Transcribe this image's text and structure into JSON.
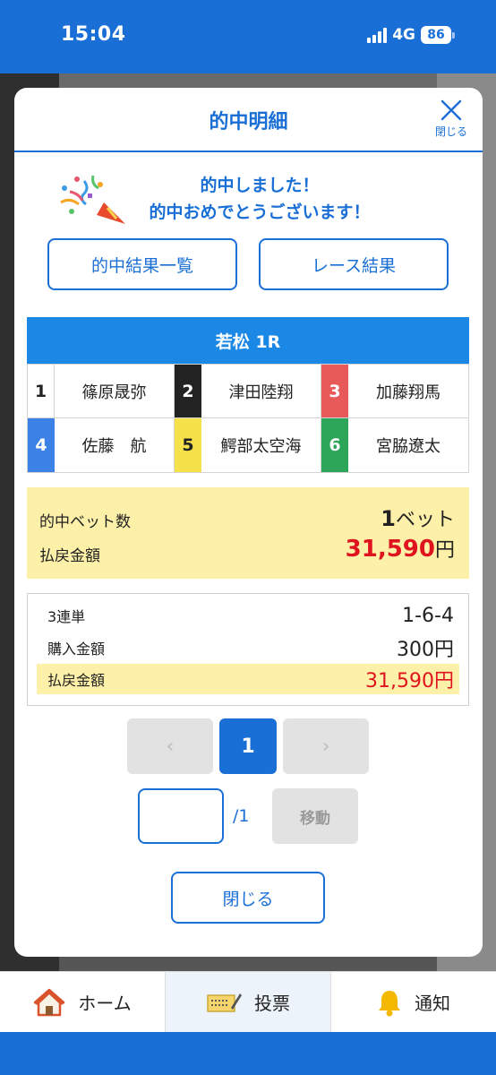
{
  "status_bar": {
    "time": "15:04",
    "network": "4G",
    "battery": "86"
  },
  "modal": {
    "title": "的中明細",
    "close_label": "閉じる",
    "congrats_line1": "的中しました！",
    "congrats_line2": "的中おめでとうございます！",
    "buttons": {
      "hit_list": "的中結果一覧",
      "race_result": "レース結果"
    },
    "race": {
      "title": "若松 1R",
      "racers": [
        {
          "lane": "1",
          "name": "篠原晟弥",
          "color": "#ffffff"
        },
        {
          "lane": "2",
          "name": "津田陸翔",
          "color": "#222222"
        },
        {
          "lane": "3",
          "name": "加藤翔馬",
          "color": "#e85a5a"
        },
        {
          "lane": "4",
          "name": "佐藤　航",
          "color": "#3c82e6"
        },
        {
          "lane": "5",
          "name": "鰐部太空海",
          "color": "#f5e14a"
        },
        {
          "lane": "6",
          "name": "宮脇遼太",
          "color": "#2ea65a"
        }
      ]
    },
    "summary": {
      "hit_bets_label": "的中ベット数",
      "hit_bets_value": "1",
      "hit_bets_unit": "ベット",
      "payout_label": "払戻金額",
      "payout_value": "31,590",
      "payout_unit": "円"
    },
    "bet_detail": {
      "type": "3連単",
      "combination": "1-6-4",
      "purchase_label": "購入金額",
      "purchase_value": "300円",
      "payout_label": "払戻金額",
      "payout_value": "31,590円"
    },
    "pagination": {
      "prev": "‹",
      "current": "1",
      "next": "›",
      "total": "/1",
      "jump_label": "移動",
      "jump_value": ""
    },
    "close_button": "閉じる"
  },
  "bottom_nav": {
    "items": [
      {
        "label": "ホーム",
        "icon": "home-icon"
      },
      {
        "label": "投票",
        "icon": "ticket-icon"
      },
      {
        "label": "通知",
        "icon": "bell-icon"
      }
    ],
    "active": "投票"
  },
  "colors": {
    "brand": "#1a6fd6",
    "highlight": "#fdf0a9",
    "payout_red": "#e0141e"
  }
}
